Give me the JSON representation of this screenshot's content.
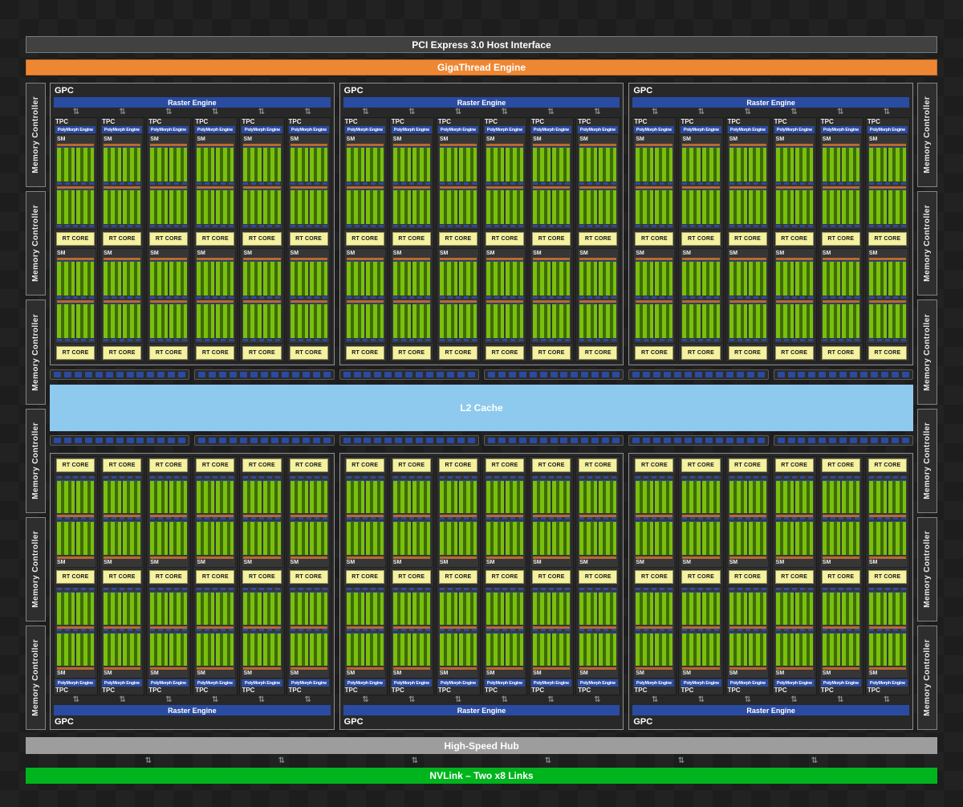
{
  "bars": {
    "pci": "PCI Express 3.0 Host Interface",
    "gigathread": "GigaThread Engine",
    "l2_cache": "L2 Cache",
    "high_speed_hub": "High-Speed Hub",
    "nvlink": "NVLink – Two x8 Links"
  },
  "labels": {
    "gpc": "GPC",
    "raster_engine": "Raster Engine",
    "tpc": "TPC",
    "polymorph_engine": "PolyMorph Engine",
    "sm": "SM",
    "rt_core": "RT CORE",
    "memory_controller": "Memory Controller"
  },
  "icons": {
    "updown_arrow": "⇅"
  },
  "layout": {
    "gpc_columns": 3,
    "gpc_rows": 2,
    "tpcs_per_gpc": 6,
    "sms_per_tpc": 2,
    "rt_cores_per_tpc": 2,
    "memory_controllers_per_side": 6,
    "l2_segments_per_row": 6,
    "dashes_per_segment": 13,
    "nvlink_arrows": 6
  },
  "colors": {
    "background": "#1d1d1d",
    "gigathread_orange": "#ee8733",
    "engine_blue": "#2a4ba2",
    "l2_light_blue": "#8ecaed",
    "rt_core_yellow": "#f4f1a1",
    "core_green_light": "#79bf0e",
    "core_green_dark": "#3f6b06",
    "scheduler_orange": "#b96a2e",
    "hub_gray": "#9d9d9d",
    "nvlink_green": "#00b41e"
  }
}
